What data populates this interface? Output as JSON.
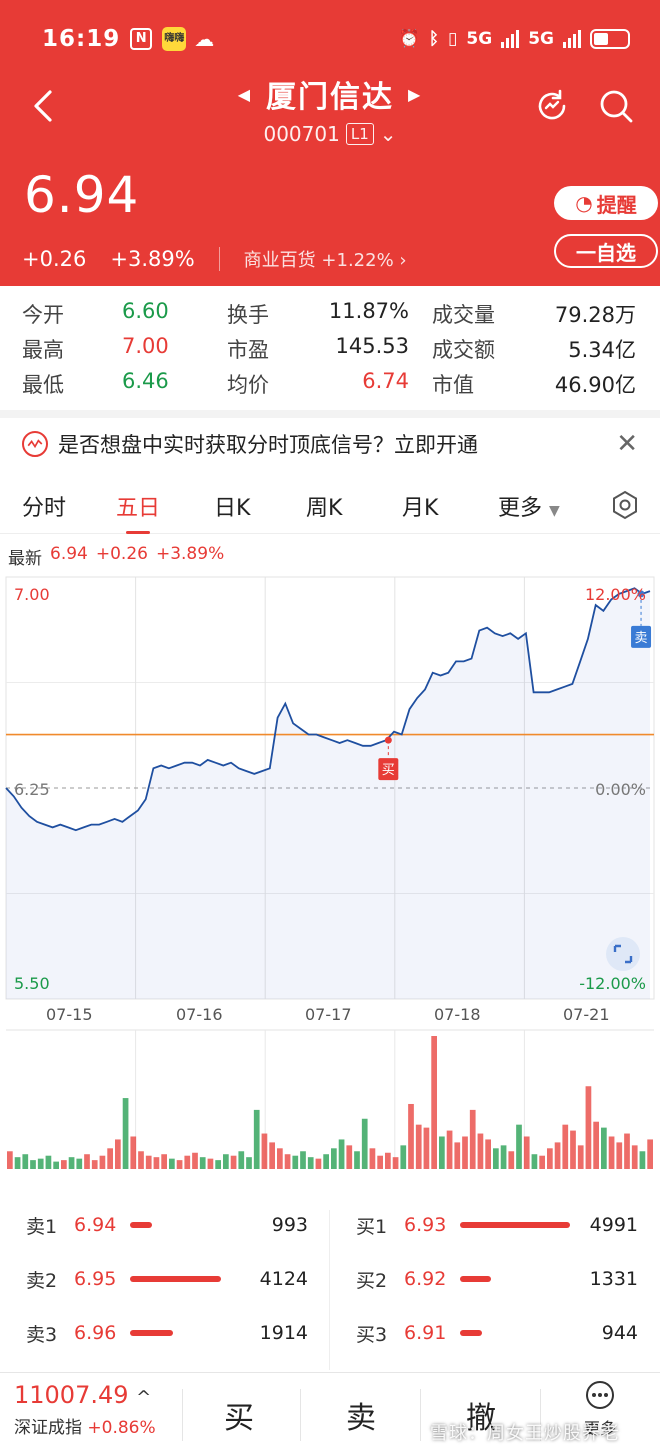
{
  "status": {
    "time": "16:19",
    "app_icon_text": "嗨嗨",
    "net1": "5G",
    "net2": "5G"
  },
  "stock": {
    "name": "厦门信达",
    "code": "000701",
    "level": "L1",
    "price": "6.94",
    "change": "+0.26",
    "change_pct": "+3.89%",
    "sector": "商业百货",
    "sector_pct": "+1.22%"
  },
  "actions": {
    "remind": "提醒",
    "favorite": "一自选"
  },
  "quote": [
    [
      {
        "k": "今开",
        "v": "6.60",
        "c": "green"
      },
      {
        "k": "换手",
        "v": "11.87%",
        "c": ""
      },
      {
        "k": "成交量",
        "v": "79.28万",
        "c": ""
      }
    ],
    [
      {
        "k": "最高",
        "v": "7.00",
        "c": "red"
      },
      {
        "k": "市盈",
        "v": "145.53",
        "c": ""
      },
      {
        "k": "成交额",
        "v": "5.34亿",
        "c": ""
      }
    ],
    [
      {
        "k": "最低",
        "v": "6.46",
        "c": "green"
      },
      {
        "k": "均价",
        "v": "6.74",
        "c": "red"
      },
      {
        "k": "市值",
        "v": "46.90亿",
        "c": ""
      }
    ]
  ],
  "banner": {
    "text": "是否想盘中实时获取分时顶底信号？立即开通"
  },
  "tabs": [
    "分时",
    "五日",
    "日K",
    "周K",
    "月K",
    "更多"
  ],
  "latest": {
    "label": "最新",
    "price": "6.94",
    "change": "+0.26",
    "pct": "+3.89%"
  },
  "chart_data": {
    "type": "line",
    "title": "",
    "x_labels": [
      "07-15",
      "07-16",
      "07-17",
      "07-18",
      "07-21"
    ],
    "ylim": [
      5.5,
      7.0
    ],
    "y_labels": [
      "7.00",
      "6.25",
      "5.50"
    ],
    "pct_labels": [
      "12.00%",
      "0.00%",
      "-12.00%"
    ],
    "prev_close": 6.25,
    "avg_line": 6.44,
    "markers": [
      {
        "label": "卖",
        "day": 4.9,
        "price": 6.94
      },
      {
        "label": "买",
        "day": 2.95,
        "price": 6.42
      }
    ],
    "price_series": [
      6.25,
      6.22,
      6.18,
      6.15,
      6.13,
      6.12,
      6.11,
      6.12,
      6.11,
      6.1,
      6.11,
      6.12,
      6.12,
      6.13,
      6.14,
      6.13,
      6.15,
      6.17,
      6.21,
      6.32,
      6.33,
      6.32,
      6.33,
      6.34,
      6.34,
      6.33,
      6.35,
      6.34,
      6.33,
      6.34,
      6.32,
      6.31,
      6.3,
      6.31,
      6.32,
      6.5,
      6.55,
      6.48,
      6.46,
      6.44,
      6.44,
      6.43,
      6.42,
      6.41,
      6.42,
      6.41,
      6.4,
      6.4,
      6.41,
      6.42,
      6.45,
      6.44,
      6.53,
      6.57,
      6.6,
      6.66,
      6.65,
      6.66,
      6.7,
      6.7,
      6.71,
      6.81,
      6.82,
      6.8,
      6.79,
      6.8,
      6.78,
      6.8,
      6.59,
      6.59,
      6.59,
      6.6,
      6.61,
      6.62,
      6.7,
      6.78,
      6.9,
      6.88,
      6.92,
      6.94,
      6.95,
      6.96,
      6.94,
      6.95
    ],
    "volume_series": [
      12,
      8,
      10,
      6,
      7,
      9,
      5,
      6,
      8,
      7,
      10,
      6,
      9,
      14,
      20,
      48,
      22,
      12,
      9,
      8,
      10,
      7,
      6,
      9,
      11,
      8,
      7,
      6,
      10,
      9,
      12,
      8,
      40,
      24,
      18,
      14,
      10,
      9,
      12,
      8,
      7,
      10,
      14,
      20,
      16,
      12,
      34,
      14,
      9,
      11,
      8,
      16,
      44,
      30,
      28,
      90,
      22,
      26,
      18,
      22,
      40,
      24,
      20,
      14,
      16,
      12,
      30,
      22,
      10,
      9,
      14,
      18,
      30,
      26,
      16,
      56,
      32,
      28,
      22,
      18,
      24,
      16,
      12,
      20
    ]
  },
  "order_book": {
    "sell": [
      {
        "lbl": "卖1",
        "price": "6.94",
        "vol": "993",
        "ratio": 0.18
      },
      {
        "lbl": "卖2",
        "price": "6.95",
        "vol": "4124",
        "ratio": 0.76
      },
      {
        "lbl": "卖3",
        "price": "6.96",
        "vol": "1914",
        "ratio": 0.36
      }
    ],
    "buy": [
      {
        "lbl": "买1",
        "price": "6.93",
        "vol": "4991",
        "ratio": 0.92
      },
      {
        "lbl": "买2",
        "price": "6.92",
        "vol": "1331",
        "ratio": 0.26
      },
      {
        "lbl": "买3",
        "price": "6.91",
        "vol": "944",
        "ratio": 0.18
      }
    ]
  },
  "bottom": {
    "index_value": "11007.49",
    "index_name": "深证成指",
    "index_pct": "+0.86%",
    "buy": "买",
    "sell": "卖",
    "cancel": "撤",
    "more": "更多",
    "watermark": "雪球：周女王炒股养老"
  },
  "colors": {
    "brand": "#e73b36",
    "line": "#1f4fa0",
    "avg": "#f08a2c",
    "up": "#e73b36",
    "down": "#1b9a4a"
  }
}
